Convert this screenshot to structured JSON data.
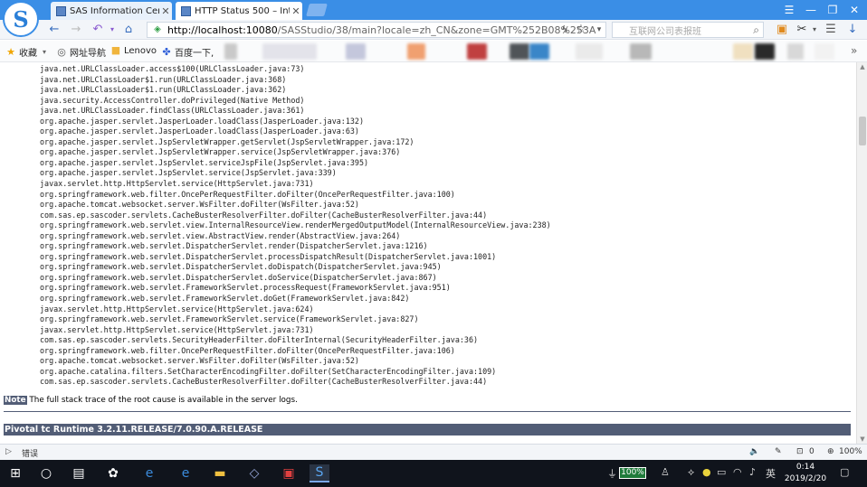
{
  "browser": {
    "tabs": [
      {
        "title": "SAS Information Cente",
        "active": false
      },
      {
        "title": "HTTP Status 500 – Intr",
        "active": true
      }
    ],
    "url_host": "http://localhost:10080",
    "url_path": "/SASStudio/38/main?locale=zh_CN&zone=GMT%252B08%253A",
    "search_placeholder": "互联网公司表报班",
    "window_controls": [
      "☰",
      "—",
      "❐",
      "✕"
    ]
  },
  "bookmarks": [
    {
      "label": "收藏",
      "icon": "star-icon"
    },
    {
      "label": "网址导航",
      "icon": "globe-icon"
    },
    {
      "label": "Lenovo",
      "icon": "folder-icon"
    },
    {
      "label": "百度一下,",
      "icon": "paw-icon"
    }
  ],
  "page": {
    "stack_trace": [
      "java.net.URLClassLoader.access$100(URLClassLoader.java:73)",
      "java.net.URLClassLoader$1.run(URLClassLoader.java:368)",
      "java.net.URLClassLoader$1.run(URLClassLoader.java:362)",
      "java.security.AccessController.doPrivileged(Native Method)",
      "java.net.URLClassLoader.findClass(URLClassLoader.java:361)",
      "org.apache.jasper.servlet.JasperLoader.loadClass(JasperLoader.java:132)",
      "org.apache.jasper.servlet.JasperLoader.loadClass(JasperLoader.java:63)",
      "org.apache.jasper.servlet.JspServletWrapper.getServlet(JspServletWrapper.java:172)",
      "org.apache.jasper.servlet.JspServletWrapper.service(JspServletWrapper.java:376)",
      "org.apache.jasper.servlet.JspServlet.serviceJspFile(JspServlet.java:395)",
      "org.apache.jasper.servlet.JspServlet.service(JspServlet.java:339)",
      "javax.servlet.http.HttpServlet.service(HttpServlet.java:731)",
      "org.springframework.web.filter.OncePerRequestFilter.doFilter(OncePerRequestFilter.java:100)",
      "org.apache.tomcat.websocket.server.WsFilter.doFilter(WsFilter.java:52)",
      "com.sas.ep.sascoder.servlets.CacheBusterResolverFilter.doFilter(CacheBusterResolverFilter.java:44)",
      "org.springframework.web.servlet.view.InternalResourceView.renderMergedOutputModel(InternalResourceView.java:238)",
      "org.springframework.web.servlet.view.AbstractView.render(AbstractView.java:264)",
      "org.springframework.web.servlet.DispatcherServlet.render(DispatcherServlet.java:1216)",
      "org.springframework.web.servlet.DispatcherServlet.processDispatchResult(DispatcherServlet.java:1001)",
      "org.springframework.web.servlet.DispatcherServlet.doDispatch(DispatcherServlet.java:945)",
      "org.springframework.web.servlet.DispatcherServlet.doService(DispatcherServlet.java:867)",
      "org.springframework.web.servlet.FrameworkServlet.processRequest(FrameworkServlet.java:951)",
      "org.springframework.web.servlet.FrameworkServlet.doGet(FrameworkServlet.java:842)",
      "javax.servlet.http.HttpServlet.service(HttpServlet.java:624)",
      "org.springframework.web.servlet.FrameworkServlet.service(FrameworkServlet.java:827)",
      "javax.servlet.http.HttpServlet.service(HttpServlet.java:731)",
      "com.sas.ep.sascoder.servlets.SecurityHeaderFilter.doFilterInternal(SecurityHeaderFilter.java:36)",
      "org.springframework.web.filter.OncePerRequestFilter.doFilter(OncePerRequestFilter.java:106)",
      "org.apache.tomcat.websocket.server.WsFilter.doFilter(WsFilter.java:52)",
      "org.apache.catalina.filters.SetCharacterEncodingFilter.doFilter(SetCharacterEncodingFilter.java:109)",
      "com.sas.ep.sascoder.servlets.CacheBusterResolverFilter.doFilter(CacheBusterResolverFilter.java:44)"
    ],
    "note_label": "Note",
    "note_text": " The full stack trace of the root cause is available in the server logs.",
    "footer": "Pivotal tc Runtime 3.2.11.RELEASE/7.0.90.A.RELEASE"
  },
  "statusbar": {
    "left_label": "错误",
    "download_count": "0",
    "zoom": "100%"
  },
  "taskbar": {
    "battery": "100%",
    "ime": "英",
    "time": "0:14",
    "date": "2019/2/20"
  }
}
